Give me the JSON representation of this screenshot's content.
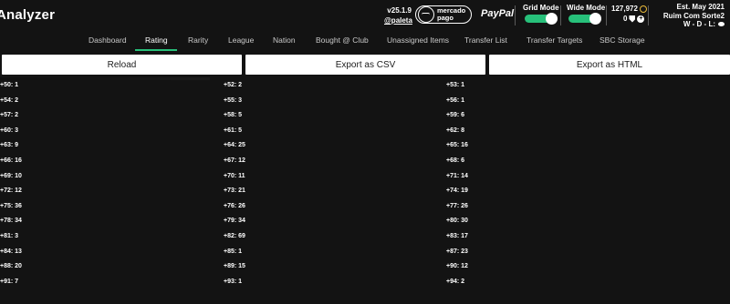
{
  "header": {
    "app_title": "Analyzer",
    "version": "v25.1.9",
    "handle": "@paleta",
    "mercado_pago_line1": "mercado",
    "mercado_pago_line2": "pago",
    "paypal": "PayPal",
    "grid_mode_label": "Grid Mode",
    "grid_mode_on": true,
    "wide_mode_label": "Wide Mode",
    "wide_mode_on": true,
    "coins": "127,972",
    "points": "0",
    "established": "Est. May 2021",
    "club_name": "Ruim Com Sorte2",
    "wdl": "W - D - L:"
  },
  "nav": {
    "items": [
      {
        "label": "Dashboard"
      },
      {
        "label": "Rating"
      },
      {
        "label": "Rarity"
      },
      {
        "label": "League"
      },
      {
        "label": "Nation"
      },
      {
        "label": "Bought @ Club"
      },
      {
        "label": "Unassigned Items"
      },
      {
        "label": "Transfer List"
      },
      {
        "label": "Transfer Targets"
      },
      {
        "label": "SBC Storage"
      }
    ],
    "active": "Rating"
  },
  "buttons": {
    "reload": "Reload",
    "export_csv": "Export as CSV",
    "export_html": "Export as HTML"
  },
  "rating_counts": {
    "col1": [
      "+50: 1",
      "+54: 2",
      "+57: 2",
      "+60: 3",
      "+63: 9",
      "+66: 16",
      "+69: 10",
      "+72: 12",
      "+75: 36",
      "+78: 34",
      "+81: 3",
      "+84: 13",
      "+88: 20",
      "+91: 7"
    ],
    "col2": [
      "+52: 2",
      "+55: 3",
      "+58: 5",
      "+61: 5",
      "+64: 25",
      "+67: 12",
      "+70: 11",
      "+73: 21",
      "+76: 26",
      "+79: 34",
      "+82: 69",
      "+85: 1",
      "+89: 15",
      "+93: 1"
    ],
    "col3": [
      "+53: 1",
      "+56: 1",
      "+59: 6",
      "+62: 8",
      "+65: 16",
      "+68: 6",
      "+71: 14",
      "+74: 19",
      "+77: 26",
      "+80: 30",
      "+83: 17",
      "+87: 23",
      "+90: 12",
      "+94: 2"
    ]
  },
  "colors": {
    "accent": "#27c07a",
    "background": "#131313",
    "coin": "#e8b93a"
  }
}
